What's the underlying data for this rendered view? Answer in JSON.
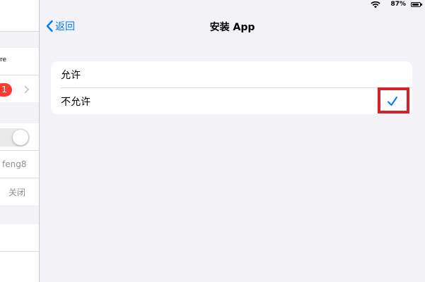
{
  "status_bar": {
    "battery_text": "87%",
    "wifi_icon": "wifi-icon",
    "battery_icon": "battery-icon",
    "battery_level": 0.87
  },
  "left_panel": {
    "partial_text_1": "re",
    "badge_count": "1",
    "value_1": "feng8",
    "value_2": "关闭"
  },
  "nav": {
    "back_label": "返回",
    "title": "安装 App"
  },
  "options": [
    {
      "label": "允许",
      "selected": false
    },
    {
      "label": "不允许",
      "selected": true
    }
  ],
  "colors": {
    "accent": "#007aff",
    "badge": "#ff3b30",
    "highlight": "#d2232a"
  }
}
